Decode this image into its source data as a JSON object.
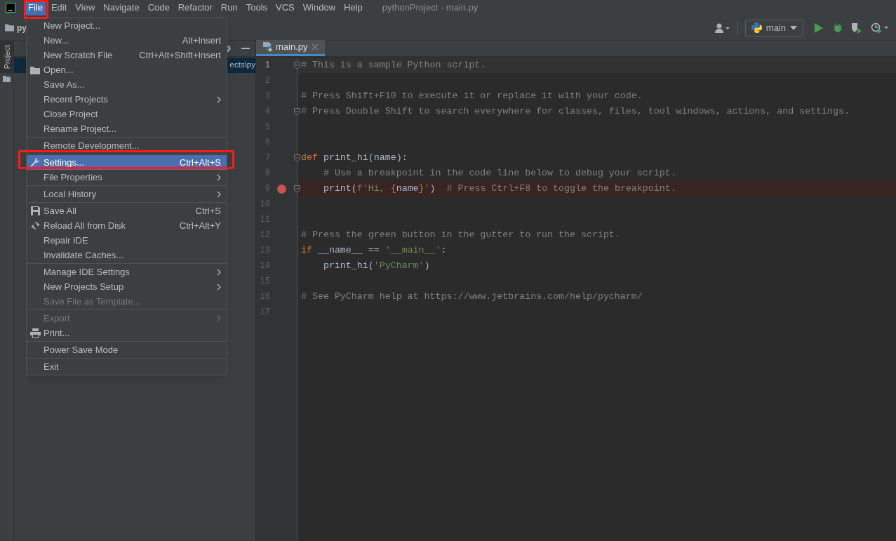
{
  "menubar": [
    {
      "label": "File",
      "selected": true
    },
    {
      "label": "Edit",
      "selected": false
    },
    {
      "label": "View",
      "selected": false
    },
    {
      "label": "Navigate",
      "selected": false
    },
    {
      "label": "Code",
      "selected": false
    },
    {
      "label": "Refactor",
      "selected": false
    },
    {
      "label": "Run",
      "selected": false
    },
    {
      "label": "Tools",
      "selected": false
    },
    {
      "label": "VCS",
      "selected": false
    },
    {
      "label": "Window",
      "selected": false
    },
    {
      "label": "Help",
      "selected": false
    }
  ],
  "window": {
    "title": "pythonProject - main.py"
  },
  "breadcrumb": "py",
  "toolbar": {
    "run_configuration": "main"
  },
  "left_stripe": {
    "tab": "Project"
  },
  "project_panel": {
    "row_text": "ects\\py"
  },
  "editor_tab": {
    "label": "main.py",
    "selected": true
  },
  "code": [
    {
      "number": "1",
      "current": true,
      "breakpoint": false,
      "fold": true,
      "tokens": [
        {
          "kind": "comment",
          "text": "# This is a sample Python script."
        }
      ]
    },
    {
      "number": "2",
      "current": false,
      "breakpoint": false,
      "fold": false
    },
    {
      "number": "3",
      "current": false,
      "breakpoint": false,
      "fold": false,
      "tokens": [
        {
          "kind": "comment",
          "text": "# Press Shift+F10 to execute it or replace it with your code."
        }
      ]
    },
    {
      "number": "4",
      "current": false,
      "breakpoint": false,
      "fold": true,
      "tokens": [
        {
          "kind": "comment",
          "text": "# Press Double Shift to search everywhere for classes, files, tool windows, actions, and settings."
        }
      ]
    },
    {
      "number": "5",
      "current": false,
      "breakpoint": false,
      "fold": false
    },
    {
      "number": "6",
      "current": false,
      "breakpoint": false,
      "fold": false
    },
    {
      "number": "7",
      "current": false,
      "breakpoint": false,
      "fold": true,
      "tokens": [
        {
          "kind": "keyword",
          "text": "def "
        },
        {
          "kind": "plain",
          "text": "print_hi(name):"
        }
      ]
    },
    {
      "number": "8",
      "current": false,
      "breakpoint": false,
      "fold": false,
      "tokens": [
        {
          "kind": "comment",
          "text": "    # Use a breakpoint in the code line below to debug your script."
        }
      ]
    },
    {
      "number": "9",
      "current": false,
      "breakpoint": true,
      "fold": true,
      "tokens": [
        {
          "kind": "plain",
          "text": "    print("
        },
        {
          "kind": "string",
          "text": "f'Hi, "
        },
        {
          "kind": "keyword",
          "text": "{"
        },
        {
          "kind": "plain",
          "text": "name"
        },
        {
          "kind": "keyword",
          "text": "}"
        },
        {
          "kind": "string",
          "text": "'"
        },
        {
          "kind": "plain",
          "text": ")  "
        },
        {
          "kind": "comment",
          "text": "# Press Ctrl+F8 to toggle the breakpoint."
        }
      ]
    },
    {
      "number": "10",
      "current": false,
      "breakpoint": false,
      "fold": false
    },
    {
      "number": "11",
      "current": false,
      "breakpoint": false,
      "fold": false
    },
    {
      "number": "12",
      "current": false,
      "breakpoint": false,
      "fold": false,
      "tokens": [
        {
          "kind": "comment",
          "text": "# Press the green button in the gutter to run the script."
        }
      ]
    },
    {
      "number": "13",
      "current": false,
      "breakpoint": false,
      "fold": false,
      "tokens": [
        {
          "kind": "keyword",
          "text": "if "
        },
        {
          "kind": "plain",
          "text": "__name__ == "
        },
        {
          "kind": "string",
          "text": "'__main__'"
        },
        {
          "kind": "plain",
          "text": ":"
        }
      ]
    },
    {
      "number": "14",
      "current": false,
      "breakpoint": false,
      "fold": false,
      "tokens": [
        {
          "kind": "plain",
          "text": "    print_hi("
        },
        {
          "kind": "string",
          "text": "'PyCharm'"
        },
        {
          "kind": "plain",
          "text": ")"
        }
      ]
    },
    {
      "number": "15",
      "current": false,
      "breakpoint": false,
      "fold": false
    },
    {
      "number": "16",
      "current": false,
      "breakpoint": false,
      "fold": false,
      "tokens": [
        {
          "kind": "comment",
          "text": "# See PyCharm help at https://www.jetbrains.com/help/pycharm/"
        }
      ]
    },
    {
      "number": "17",
      "current": false,
      "breakpoint": false,
      "fold": false
    }
  ],
  "file_menu": [
    {
      "kind": "item",
      "label": "New Project...",
      "disabled": false,
      "selected": false,
      "submenu": false
    },
    {
      "kind": "item",
      "label": "New...",
      "shortcut": "Alt+Insert",
      "disabled": false,
      "selected": false,
      "submenu": false
    },
    {
      "kind": "item",
      "label": "New Scratch File",
      "shortcut": "Ctrl+Alt+Shift+Insert",
      "disabled": false,
      "selected": false,
      "submenu": false
    },
    {
      "kind": "folder",
      "label": "Open...",
      "disabled": false,
      "selected": false,
      "submenu": false
    },
    {
      "kind": "item",
      "label": "Save As...",
      "disabled": false,
      "selected": false,
      "submenu": false
    },
    {
      "kind": "item",
      "label": "Recent Projects",
      "disabled": false,
      "selected": false,
      "submenu": true
    },
    {
      "kind": "item",
      "label": "Close Project",
      "disabled": false,
      "selected": false,
      "submenu": false
    },
    {
      "kind": "item",
      "label": "Rename Project...",
      "disabled": false,
      "selected": false,
      "submenu": false
    },
    {
      "kind": "separator"
    },
    {
      "kind": "item",
      "label": "Remote Development...",
      "disabled": false,
      "selected": false,
      "submenu": false
    },
    {
      "kind": "separator"
    },
    {
      "kind": "wrench",
      "label": "Settings...",
      "shortcut": "Ctrl+Alt+S",
      "disabled": false,
      "selected": true,
      "submenu": false
    },
    {
      "kind": "item",
      "label": "File Properties",
      "disabled": false,
      "selected": false,
      "submenu": true
    },
    {
      "kind": "separator"
    },
    {
      "kind": "item",
      "label": "Local History",
      "disabled": false,
      "selected": false,
      "submenu": true
    },
    {
      "kind": "separator"
    },
    {
      "kind": "floppy",
      "label": "Save All",
      "shortcut": "Ctrl+S",
      "disabled": false,
      "selected": false,
      "submenu": false
    },
    {
      "kind": "reload",
      "label": "Reload All from Disk",
      "shortcut": "Ctrl+Alt+Y",
      "disabled": false,
      "selected": false,
      "submenu": false
    },
    {
      "kind": "item",
      "label": "Repair IDE",
      "disabled": false,
      "selected": false,
      "submenu": false
    },
    {
      "kind": "item",
      "label": "Invalidate Caches...",
      "disabled": false,
      "selected": false,
      "submenu": false
    },
    {
      "kind": "separator"
    },
    {
      "kind": "item",
      "label": "Manage IDE Settings",
      "disabled": false,
      "selected": false,
      "submenu": true
    },
    {
      "kind": "item",
      "label": "New Projects Setup",
      "disabled": false,
      "selected": false,
      "submenu": true
    },
    {
      "kind": "item",
      "label": "Save File as Template...",
      "disabled": true,
      "selected": false,
      "submenu": false
    },
    {
      "kind": "separator"
    },
    {
      "kind": "item",
      "label": "Export",
      "disabled": true,
      "selected": false,
      "submenu": true
    },
    {
      "kind": "printer",
      "label": "Print...",
      "disabled": false,
      "selected": false,
      "submenu": false
    },
    {
      "kind": "separator"
    },
    {
      "kind": "item",
      "label": "Power Save Mode",
      "disabled": false,
      "selected": false,
      "submenu": false
    },
    {
      "kind": "separator"
    },
    {
      "kind": "item",
      "label": "Exit",
      "disabled": false,
      "selected": false,
      "submenu": false
    }
  ]
}
